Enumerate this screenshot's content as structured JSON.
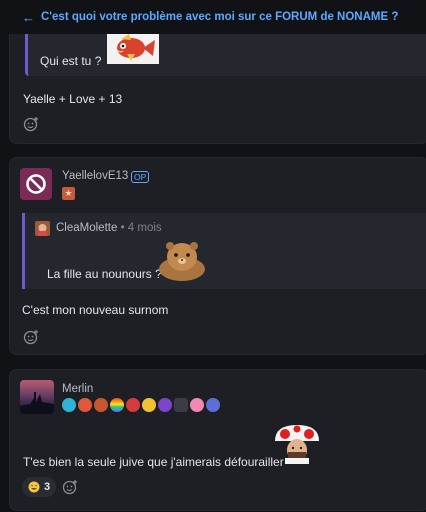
{
  "topic": {
    "back_icon": "arrow-left-icon",
    "title": "C'est quoi votre problème avec moi sur ce FORUM de NONAME ?"
  },
  "posts": [
    {
      "quote": {
        "text": "Qui est tu ?",
        "sticker": "magikarp-sticker"
      },
      "body": "Yaelle + Love + 13",
      "react_icon": "add-reaction-icon"
    },
    {
      "author": "YaellelovE13",
      "op_badge": "OP",
      "avatar": "blocked-avatar-icon",
      "quote": {
        "author": "CleaMolette",
        "meta": "• 4 mois",
        "text": "La fille au nounours ?",
        "sticker": "hamster-sticker"
      },
      "body": "C'est mon nouveau surnom",
      "react_icon": "add-reaction-icon"
    },
    {
      "author": "Merlin",
      "avatar": "sunset-avatar",
      "body": "T'es bien la seule juive que j'aimerais défourailler",
      "sticker": "mushroom-man-sticker",
      "reaction": {
        "emoji": "laughing-emoji",
        "count": "3"
      },
      "react_icon": "add-reaction-icon"
    }
  ]
}
